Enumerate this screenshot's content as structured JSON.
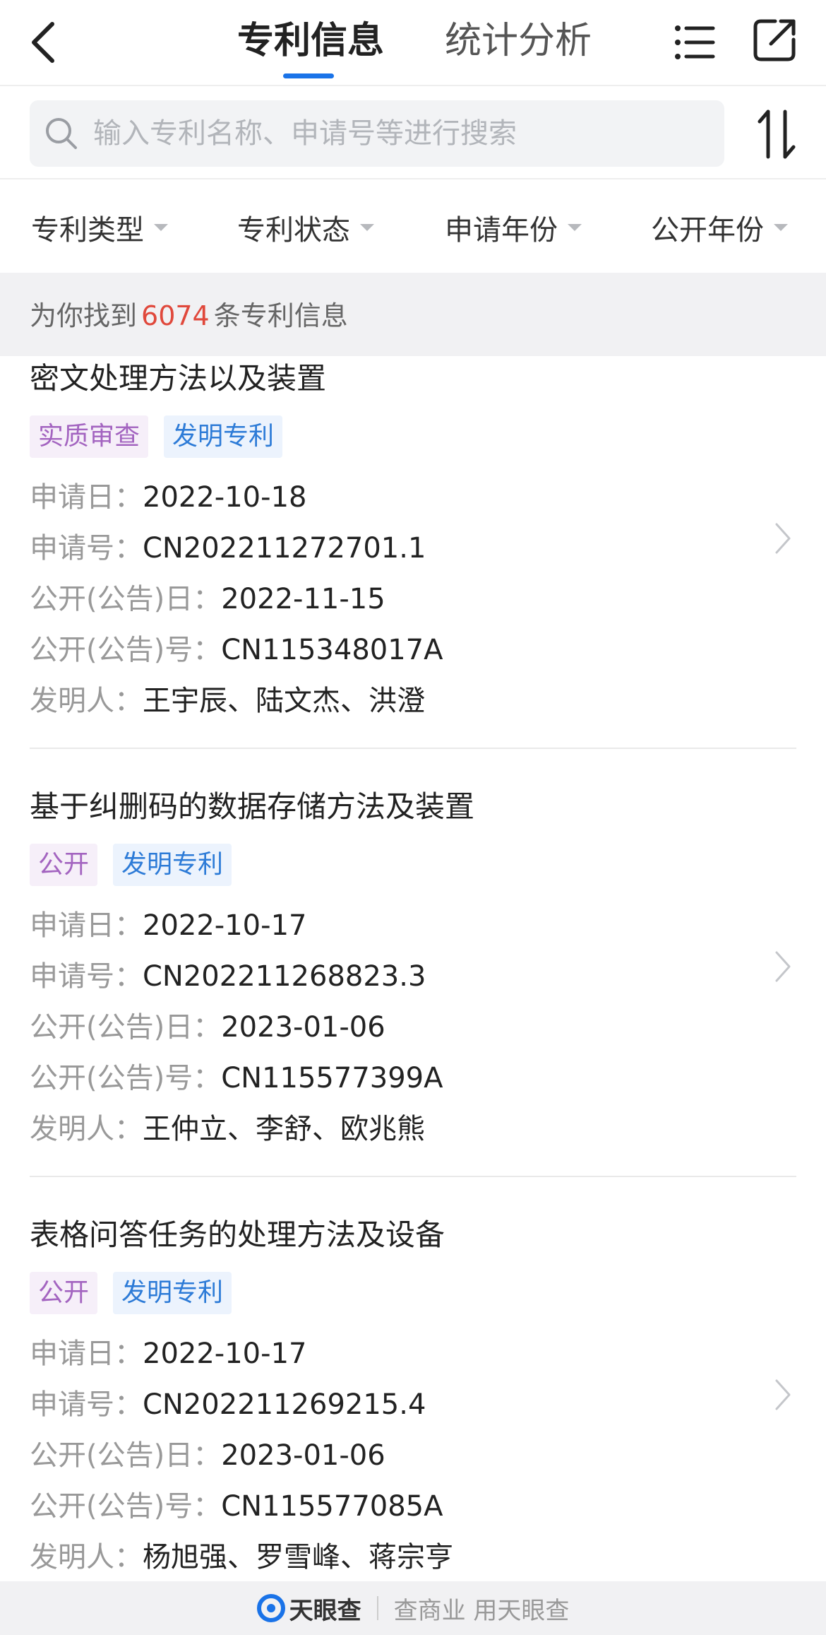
{
  "header": {
    "tabs": [
      {
        "label": "专利信息",
        "active": true
      },
      {
        "label": "统计分析",
        "active": false
      }
    ],
    "accent_color": "#1a73e8",
    "icons": [
      "chevron-left-icon",
      "list-icon",
      "share-icon"
    ]
  },
  "search": {
    "placeholder": "输入专利名称、申请号等进行搜索",
    "value": ""
  },
  "filters": [
    {
      "label": "专利类型"
    },
    {
      "label": "专利状态"
    },
    {
      "label": "申请年份"
    },
    {
      "label": "公开年份"
    }
  ],
  "result_count": {
    "prefix": "为你找到",
    "count": "6074",
    "suffix": "条专利信息",
    "count_color": "#e0483b"
  },
  "field_labels": {
    "apply_date": "申请日：",
    "apply_no": "申请号：",
    "pub_date": "公开(公告)日：",
    "pub_no": "公开(公告)号：",
    "inventors": "发明人："
  },
  "patents": [
    {
      "title": "密文处理方法以及装置",
      "status_tag": "实质审查",
      "type_tag": "发明专利",
      "apply_date": "2022-10-18",
      "apply_no": "CN202211272701.1",
      "pub_date": "2022-11-15",
      "pub_no": "CN115348017A",
      "inventors": "王宇辰、陆文杰、洪澄"
    },
    {
      "title": "基于纠删码的数据存储方法及装置",
      "status_tag": "公开",
      "type_tag": "发明专利",
      "apply_date": "2022-10-17",
      "apply_no": "CN202211268823.3",
      "pub_date": "2023-01-06",
      "pub_no": "CN115577399A",
      "inventors": "王仲立、李舒、欧兆熊"
    },
    {
      "title": "表格问答任务的处理方法及设备",
      "status_tag": "公开",
      "type_tag": "发明专利",
      "apply_date": "2022-10-17",
      "apply_no": "CN202211269215.4",
      "pub_date": "2023-01-06",
      "pub_no": "CN115577085A",
      "inventors": "杨旭强、罗雪峰、蒋宗亨"
    }
  ],
  "footer": {
    "logo_text": "天眼查",
    "slogan": "查商业 用天眼查",
    "logo_color": "#1a73e8"
  }
}
